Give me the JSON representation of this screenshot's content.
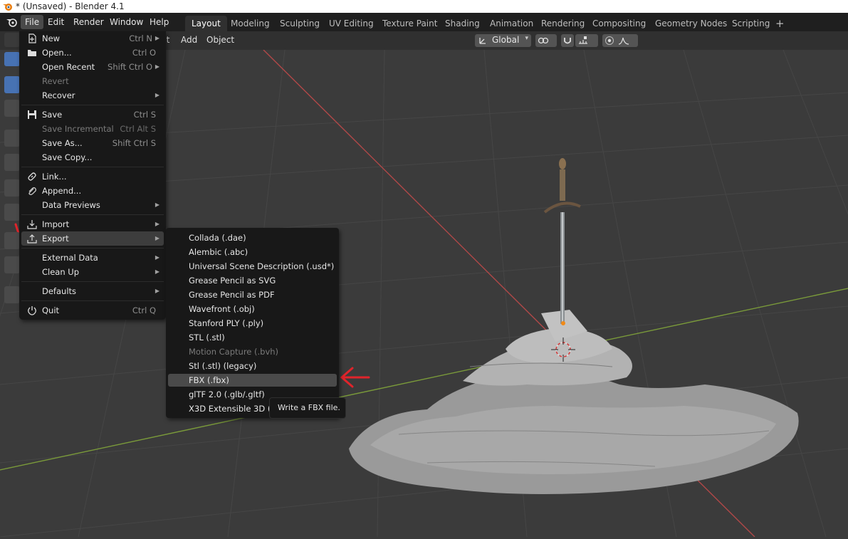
{
  "window": {
    "title": "* (Unsaved) - Blender 4.1"
  },
  "menubar": {
    "items": [
      "File",
      "Edit",
      "Render",
      "Window",
      "Help"
    ]
  },
  "workspaces": [
    "Layout",
    "Modeling",
    "Sculpting",
    "UV Editing",
    "Texture Paint",
    "Shading",
    "Animation",
    "Rendering",
    "Compositing",
    "Geometry Nodes",
    "Scripting"
  ],
  "workspace_add": "+",
  "header": {
    "select_partial": "ct",
    "add": "Add",
    "object": "Object",
    "orientation": "Global"
  },
  "file_menu": [
    {
      "label": "New",
      "shortcut": "Ctrl N",
      "submenu": true,
      "icon": "new-file-icon"
    },
    {
      "label": "Open...",
      "shortcut": "Ctrl O",
      "icon": "folder-icon"
    },
    {
      "label": "Open Recent",
      "shortcut": "Shift Ctrl O",
      "submenu": true
    },
    {
      "label": "Revert",
      "disabled": true
    },
    {
      "label": "Recover",
      "submenu": true
    },
    {
      "label": "Save",
      "shortcut": "Ctrl S",
      "icon": "save-icon"
    },
    {
      "label": "Save Incremental",
      "shortcut": "Ctrl Alt S",
      "disabled": true
    },
    {
      "label": "Save As...",
      "shortcut": "Shift Ctrl S"
    },
    {
      "label": "Save Copy..."
    },
    {
      "label": "Link...",
      "icon": "link-icon"
    },
    {
      "label": "Append...",
      "icon": "append-icon"
    },
    {
      "label": "Data Previews",
      "submenu": true
    },
    {
      "label": "Import",
      "submenu": true,
      "icon": "import-icon"
    },
    {
      "label": "Export",
      "submenu": true,
      "icon": "export-icon",
      "highlight": true
    },
    {
      "label": "External Data",
      "submenu": true
    },
    {
      "label": "Clean Up",
      "submenu": true
    },
    {
      "label": "Defaults",
      "submenu": true
    },
    {
      "label": "Quit",
      "shortcut": "Ctrl Q",
      "icon": "power-icon"
    }
  ],
  "export_menu": [
    {
      "label": "Collada (.dae)"
    },
    {
      "label": "Alembic (.abc)"
    },
    {
      "label": "Universal Scene Description (.usd*)"
    },
    {
      "label": "Grease Pencil as SVG"
    },
    {
      "label": "Grease Pencil as PDF"
    },
    {
      "label": "Wavefront (.obj)"
    },
    {
      "label": "Stanford PLY (.ply)"
    },
    {
      "label": "STL (.stl)"
    },
    {
      "label": "Motion Capture (.bvh)",
      "disabled": true
    },
    {
      "label": "Stl (.stl) (legacy)"
    },
    {
      "label": "FBX (.fbx)",
      "highlight": true
    },
    {
      "label": "glTF 2.0 (.glb/.gltf)"
    },
    {
      "label": "X3D Extensible 3D (.x"
    }
  ],
  "tooltip": "Write a FBX file.",
  "colors": {
    "accent": "#4772b3",
    "annotation": "#e0242b",
    "grid_x": "#b04848",
    "grid_y": "#7a9a3a"
  }
}
